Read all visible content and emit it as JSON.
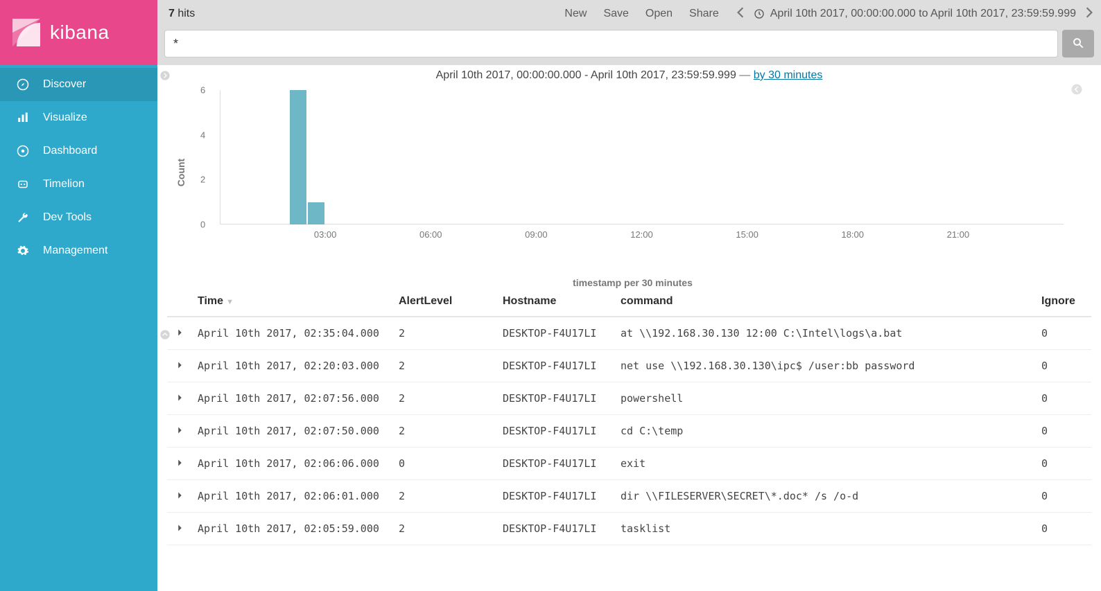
{
  "brand": {
    "name": "kibana"
  },
  "sidebar": {
    "items": [
      {
        "label": "Discover",
        "icon": "compass",
        "selected": true
      },
      {
        "label": "Visualize",
        "icon": "bar-chart",
        "selected": false
      },
      {
        "label": "Dashboard",
        "icon": "gauge",
        "selected": false
      },
      {
        "label": "Timelion",
        "icon": "robot",
        "selected": false
      },
      {
        "label": "Dev Tools",
        "icon": "wrench",
        "selected": false
      },
      {
        "label": "Management",
        "icon": "gear",
        "selected": false
      }
    ]
  },
  "topbar": {
    "hits_count": "7",
    "hits_label": " hits",
    "actions": {
      "new": "New",
      "save": "Save",
      "open": "Open",
      "share": "Share"
    },
    "time_range": "April 10th 2017, 00:00:00.000 to April 10th 2017, 23:59:59.999"
  },
  "search": {
    "value": "*"
  },
  "histogram": {
    "title_prefix": "April 10th 2017, 00:00:00.000 - April 10th 2017, 23:59:59.999",
    "title_dash": " — ",
    "interval_link": "by 30 minutes",
    "ylabel": "Count",
    "xlabel": "timestamp per 30 minutes"
  },
  "chart_data": {
    "type": "bar",
    "title": "April 10th 2017, 00:00:00.000 - April 10th 2017, 23:59:59.999 — by 30 minutes",
    "xlabel": "timestamp per 30 minutes",
    "ylabel": "Count",
    "x_ticks": [
      "03:00",
      "06:00",
      "09:00",
      "12:00",
      "15:00",
      "18:00",
      "21:00"
    ],
    "y_ticks": [
      0,
      2,
      4,
      6
    ],
    "ylim": [
      0,
      6
    ],
    "categories": [
      "02:00",
      "02:30"
    ],
    "values": [
      6,
      1
    ]
  },
  "table": {
    "columns": {
      "time": "Time",
      "alert": "AlertLevel",
      "host": "Hostname",
      "command": "command",
      "ignore": "Ignore"
    },
    "rows": [
      {
        "time": "April 10th 2017, 02:35:04.000",
        "alert": "2",
        "host": "DESKTOP-F4U17LI",
        "command": "at \\\\192.168.30.130 12:00 C:\\Intel\\logs\\a.bat",
        "ignore": "0"
      },
      {
        "time": "April 10th 2017, 02:20:03.000",
        "alert": "2",
        "host": "DESKTOP-F4U17LI",
        "command": "net use \\\\192.168.30.130\\ipc$ /user:bb password",
        "ignore": "0"
      },
      {
        "time": "April 10th 2017, 02:07:56.000",
        "alert": "2",
        "host": "DESKTOP-F4U17LI",
        "command": "powershell",
        "ignore": "0"
      },
      {
        "time": "April 10th 2017, 02:07:50.000",
        "alert": "2",
        "host": "DESKTOP-F4U17LI",
        "command": "cd C:\\temp",
        "ignore": "0"
      },
      {
        "time": "April 10th 2017, 02:06:06.000",
        "alert": "0",
        "host": "DESKTOP-F4U17LI",
        "command": "exit",
        "ignore": "0"
      },
      {
        "time": "April 10th 2017, 02:06:01.000",
        "alert": "2",
        "host": "DESKTOP-F4U17LI",
        "command": "dir \\\\FILESERVER\\SECRET\\*.doc* /s /o-d",
        "ignore": "0"
      },
      {
        "time": "April 10th 2017, 02:05:59.000",
        "alert": "2",
        "host": "DESKTOP-F4U17LI",
        "command": "tasklist",
        "ignore": "0"
      }
    ]
  }
}
